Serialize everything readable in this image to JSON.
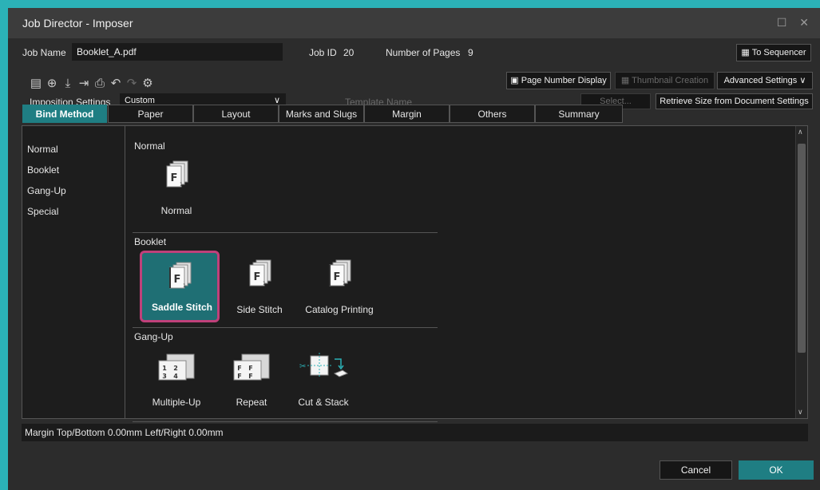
{
  "window": {
    "title": "Job Director - Imposer",
    "controls": "☐ ✕"
  },
  "job": {
    "name_label": "Job Name",
    "name_value": "Booklet_A.pdf",
    "id_label": "Job ID",
    "id_value": "20",
    "pages_label": "Number of Pages",
    "pages_value": "9",
    "to_sequencer": "To Sequencer"
  },
  "toolbar": {
    "icons": [
      "list-icon",
      "add-icon",
      "download-icon",
      "export-icon",
      "print-icon",
      "undo-icon",
      "redo-icon",
      "settings-icon"
    ],
    "page_number_display": "Page Number Display",
    "thumbnail_creation": "Thumbnail Creation",
    "advanced_settings": "Advanced Settings"
  },
  "imposition": {
    "label": "Imposition Settings",
    "value": "Custom",
    "template_label": "Template Name",
    "select_button": "Select...",
    "retrieve_button": "Retrieve Size from Document Settings"
  },
  "tabs": [
    "Bind Method",
    "Paper",
    "Layout",
    "Marks and Slugs",
    "Margin",
    "Others",
    "Summary"
  ],
  "active_tab": "Bind Method",
  "sidebar": [
    "Normal",
    "Booklet",
    "Gang-Up",
    "Special"
  ],
  "sections": {
    "normal": {
      "title": "Normal",
      "items": [
        "Normal"
      ]
    },
    "booklet": {
      "title": "Booklet",
      "items": [
        "Saddle Stitch",
        "Side Stitch",
        "Catalog Printing"
      ],
      "selected": "Saddle Stitch"
    },
    "gangup": {
      "title": "Gang-Up",
      "items": [
        "Multiple-Up",
        "Repeat",
        "Cut & Stack"
      ]
    }
  },
  "status": {
    "text": "Margin  Top/Bottom  0.00mm  Left/Right  0.00mm"
  },
  "buttons": {
    "cancel": "Cancel",
    "ok": "OK"
  },
  "colors": {
    "accent": "#1f7e83",
    "selection_border": "#c0407a",
    "background": "#2c2c2c"
  }
}
